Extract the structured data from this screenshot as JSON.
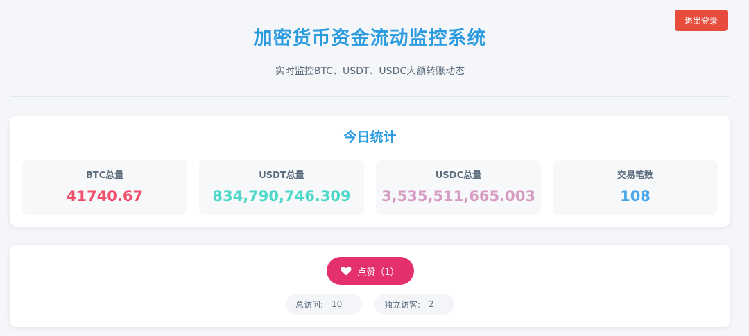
{
  "header": {
    "title": "加密货币资金流动监控系统",
    "subtitle": "实时监控BTC、USDT、USDC大额转账动态",
    "logout_label": "退出登录"
  },
  "stats": {
    "title": "今日统计",
    "items": [
      {
        "label": "BTC总量",
        "value": "41740.67",
        "color": "#ef4f6a"
      },
      {
        "label": "USDT总量",
        "value": "834,790,746.309",
        "color": "#4fd8c9"
      },
      {
        "label": "USDC总量",
        "value": "3,535,511,665.003",
        "color": "#d79bc3"
      },
      {
        "label": "交易笔数",
        "value": "108",
        "color": "#4aa8ea"
      }
    ]
  },
  "likes": {
    "icon": "heart-icon",
    "label": "点赞（1）"
  },
  "visits": {
    "total_label": "总访问:",
    "total_value": "10",
    "unique_label": "独立访客:",
    "unique_value": "2"
  },
  "colors": {
    "accent": "#2b9be0",
    "logout": "#e84c3d",
    "like": "#e4306c"
  }
}
